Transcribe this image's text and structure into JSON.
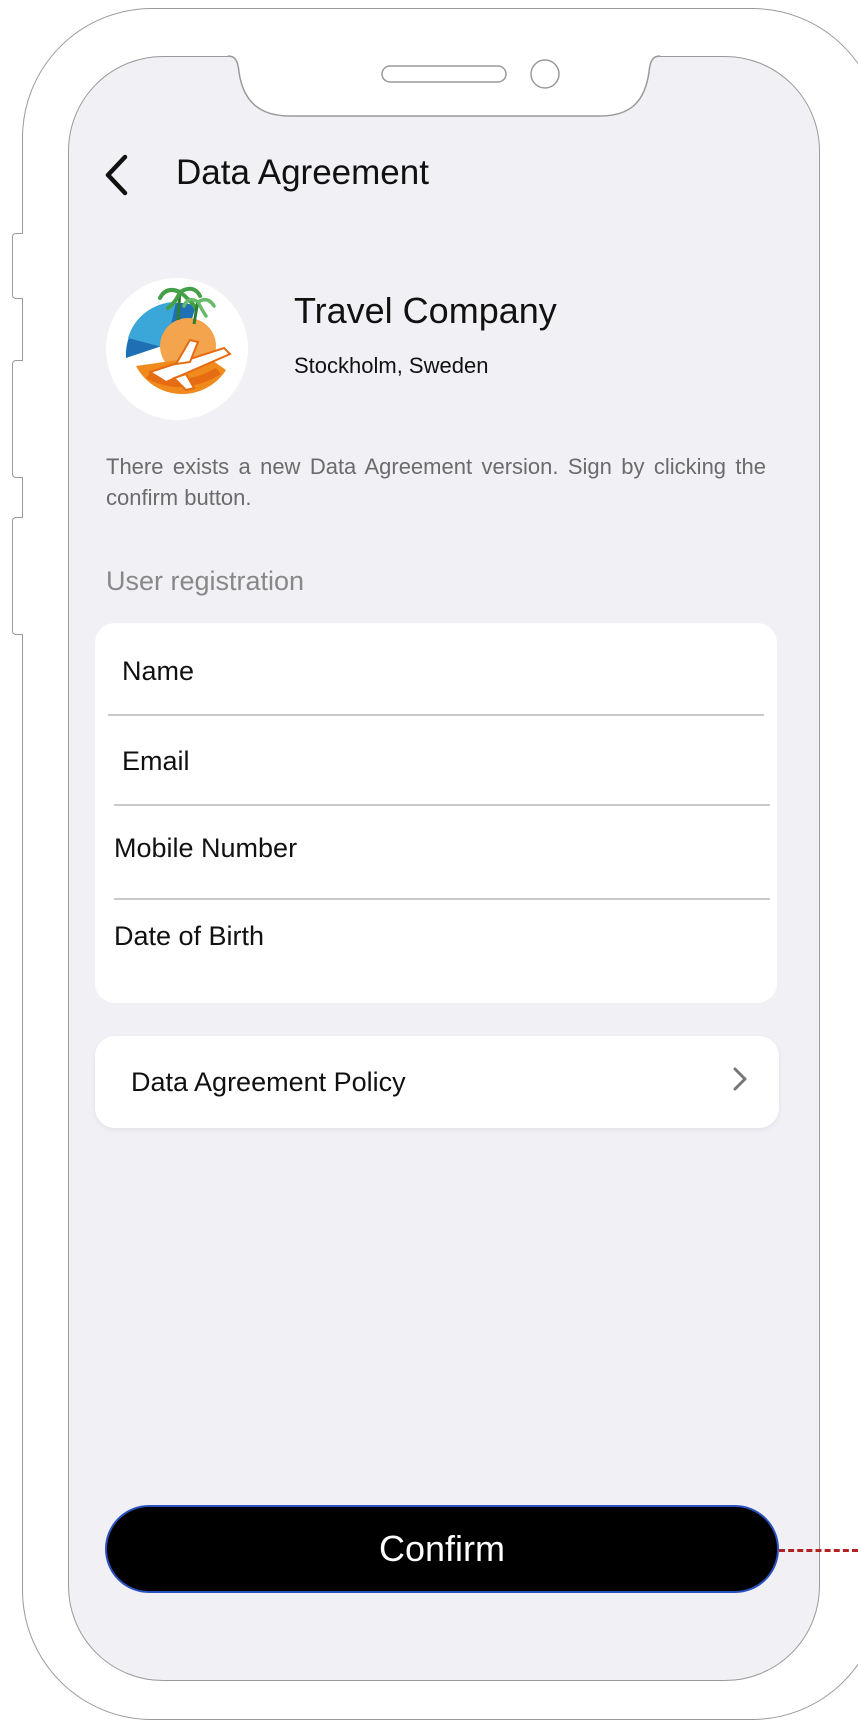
{
  "header": {
    "title": "Data Agreement",
    "back_icon": "chevron-left-icon"
  },
  "company": {
    "name": "Travel Company",
    "location": "Stockholm, Sweden",
    "logo_icon": "travel-globe-plane-palm-logo"
  },
  "notice": "There exists a new Data Agreement version. Sign by clicking the confirm button.",
  "section": {
    "label": "User registration"
  },
  "fields": [
    "Name",
    "Email",
    "Mobile Number",
    "Date of Birth"
  ],
  "policy": {
    "label": "Data Agreement Policy",
    "icon": "chevron-right-icon"
  },
  "confirm": {
    "label": "Confirm"
  },
  "colors": {
    "screen_bg": "#f1f0f5",
    "button_bg": "#000000",
    "button_border": "#2a52be",
    "annotation_line": "#b22222"
  }
}
